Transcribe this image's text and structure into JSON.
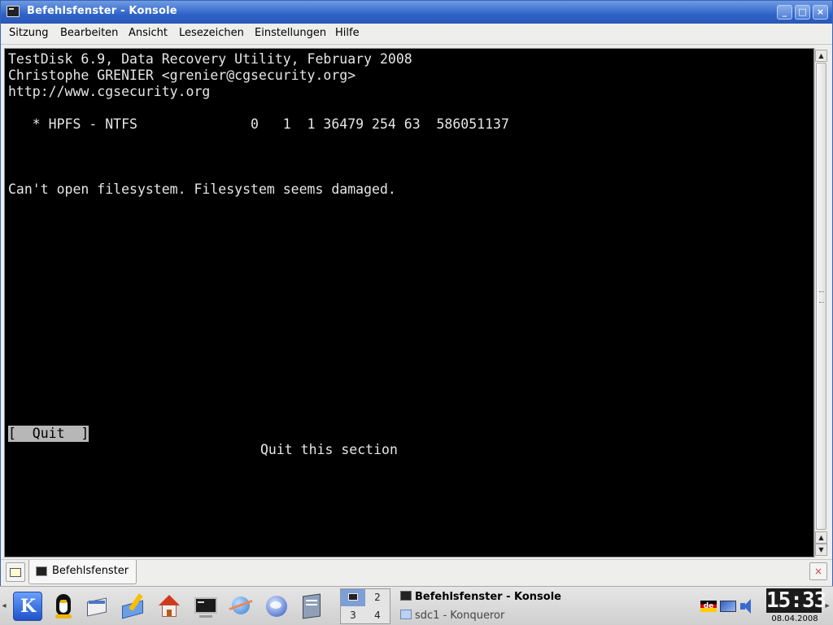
{
  "window": {
    "title": "Befehlsfenster - Konsole",
    "controls": {
      "minimize": "_",
      "maximize": "□",
      "close": "×"
    }
  },
  "menubar": [
    "Sitzung",
    "Bearbeiten",
    "Ansicht",
    "Lesezeichen",
    "Einstellungen",
    "Hilfe"
  ],
  "terminal": {
    "lines": [
      "TestDisk 6.9, Data Recovery Utility, February 2008",
      "Christophe GRENIER <grenier@cgsecurity.org>",
      "http://www.cgsecurity.org",
      "   * HPFS - NTFS              0   1  1 36479 254 63  586051137",
      "Can't open filesystem. Filesystem seems damaged."
    ],
    "quit_button": "[  Quit  ]",
    "quit_description": "Quit this section"
  },
  "scrollbar": {
    "up": "▲",
    "down": "▼"
  },
  "session_tabs": [
    {
      "label": "Befehlsfenster"
    }
  ],
  "panel": {
    "pager": [
      "1",
      "2",
      "3",
      "4"
    ],
    "tasks": [
      {
        "label": "Befehlsfenster - Konsole",
        "active": true
      },
      {
        "label": "sdc1 - Konqueror",
        "active": false
      }
    ],
    "tray": {
      "keyboard_layout": "de"
    },
    "clock": "15:33",
    "date": "08.04.2008"
  },
  "colors": {
    "titlebar": "#2f63c8",
    "terminal_bg": "#000000",
    "terminal_fg": "#e6e6e6",
    "quit_highlight": "#b7b7b7"
  },
  "icons": {
    "quick_launch": [
      "kde-menu-icon",
      "penguin-icon",
      "window-list-icon",
      "kontact-icon",
      "home-icon",
      "konsole-icon",
      "network-icon",
      "konqueror-icon",
      "office-icon"
    ]
  }
}
